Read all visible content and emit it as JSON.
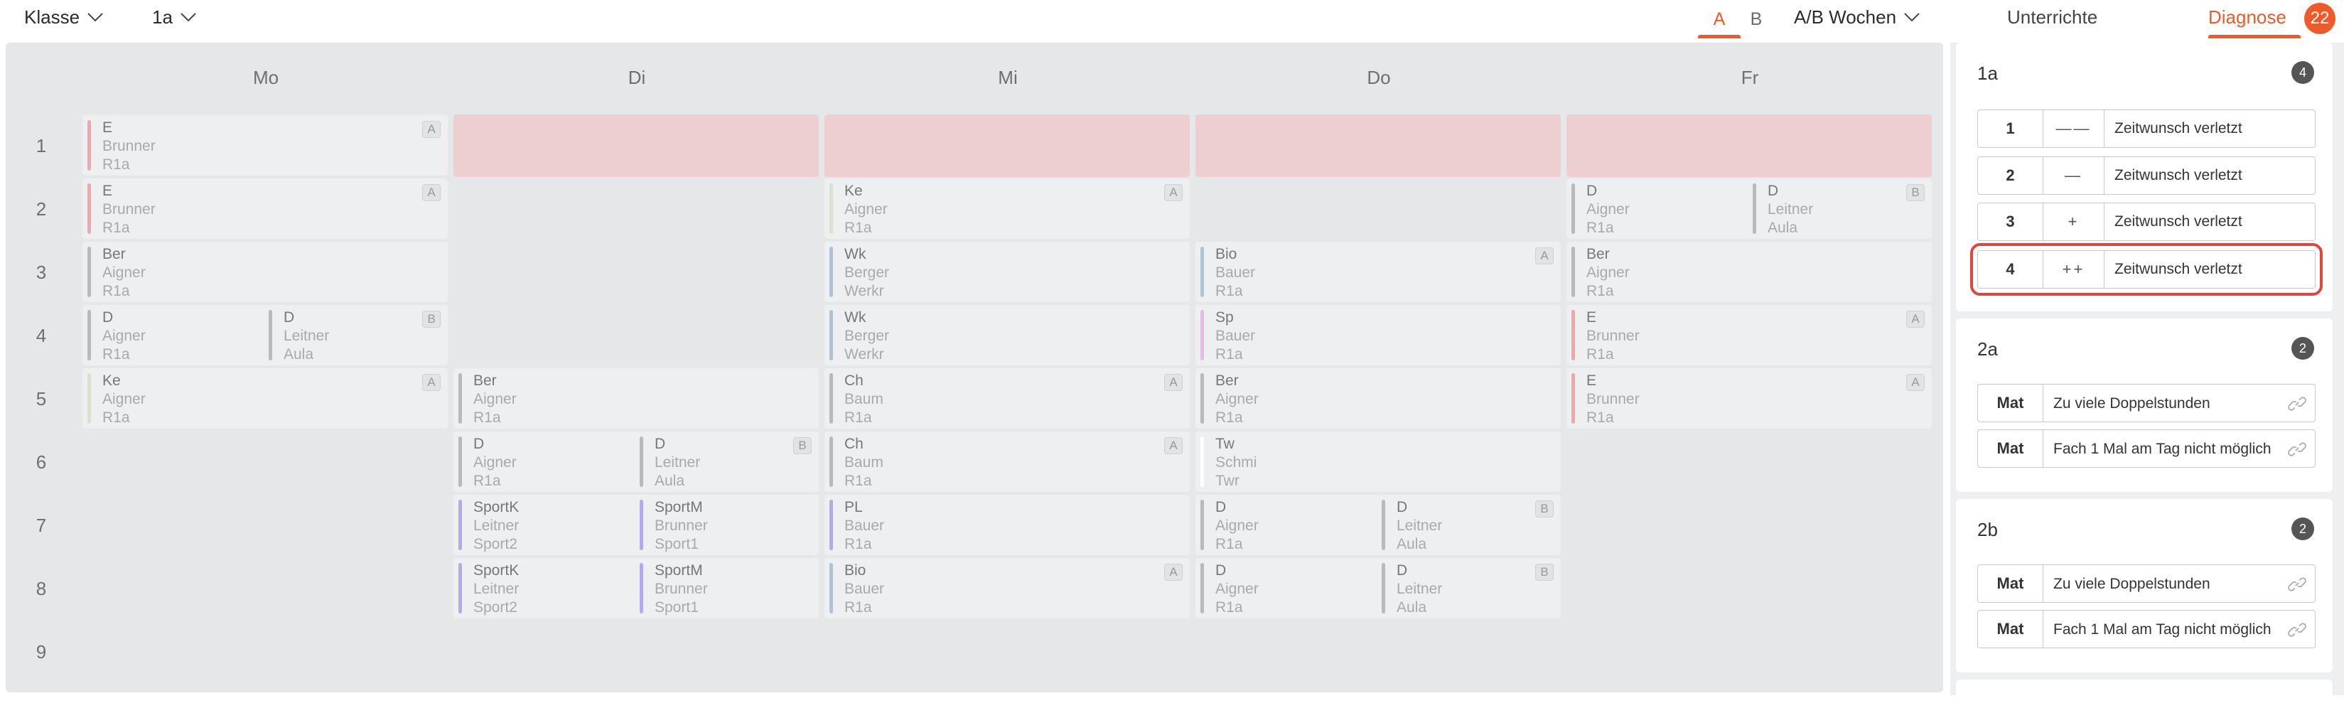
{
  "topbar": {
    "klasse_label": "Klasse",
    "class_value": "1a",
    "ab_tab_a": "A",
    "ab_tab_b": "B",
    "ab_weeks_label": "A/B Wochen",
    "tab_unterrichte": "Unterrichte",
    "tab_diagnose": "Diagnose",
    "diagnose_count": "22",
    "accent_color": "#f05a28"
  },
  "timetable": {
    "days": [
      "Mo",
      "Di",
      "Mi",
      "Do",
      "Fr"
    ],
    "periods": [
      "1",
      "2",
      "3",
      "4",
      "5",
      "6",
      "7",
      "8",
      "9"
    ],
    "lessons": {
      "mo1": {
        "subject": "E",
        "teacher": "Brunner",
        "room": "R1a",
        "tag": "A"
      },
      "mo2": {
        "subject": "E",
        "teacher": "Brunner",
        "room": "R1a",
        "tag": "A"
      },
      "mo3": {
        "subject": "Ber",
        "teacher": "Aigner",
        "room": "R1a"
      },
      "mo4a": {
        "subject": "D",
        "teacher": "Aigner",
        "room": "R1a"
      },
      "mo4b": {
        "subject": "D",
        "teacher": "Leitner",
        "room": "Aula",
        "tag": "B"
      },
      "mo5": {
        "subject": "Ke",
        "teacher": "Aigner",
        "room": "R1a",
        "tag": "A"
      },
      "di5": {
        "subject": "Ber",
        "teacher": "Aigner",
        "room": "R1a"
      },
      "di6a": {
        "subject": "D",
        "teacher": "Aigner",
        "room": "R1a"
      },
      "di6b": {
        "subject": "D",
        "teacher": "Leitner",
        "room": "Aula",
        "tag": "B"
      },
      "di7a": {
        "subject": "SportK",
        "teacher": "Leitner",
        "room": "Sport2"
      },
      "di7b": {
        "subject": "SportM",
        "teacher": "Brunner",
        "room": "Sport1"
      },
      "di8a": {
        "subject": "SportK",
        "teacher": "Leitner",
        "room": "Sport2"
      },
      "di8b": {
        "subject": "SportM",
        "teacher": "Brunner",
        "room": "Sport1"
      },
      "mi2": {
        "subject": "Ke",
        "teacher": "Aigner",
        "room": "R1a",
        "tag": "A"
      },
      "mi3": {
        "subject": "Wk",
        "teacher": "Berger",
        "room": "Werkr"
      },
      "mi4": {
        "subject": "Wk",
        "teacher": "Berger",
        "room": "Werkr"
      },
      "mi5": {
        "subject": "Ch",
        "teacher": "Baum",
        "room": "R1a",
        "tag": "A"
      },
      "mi6": {
        "subject": "Ch",
        "teacher": "Baum",
        "room": "R1a",
        "tag": "A"
      },
      "mi7": {
        "subject": "PL",
        "teacher": "Bauer",
        "room": "R1a"
      },
      "mi8": {
        "subject": "Bio",
        "teacher": "Bauer",
        "room": "R1a",
        "tag": "A"
      },
      "do3": {
        "subject": "Bio",
        "teacher": "Bauer",
        "room": "R1a",
        "tag": "A"
      },
      "do4": {
        "subject": "Sp",
        "teacher": "Bauer",
        "room": "R1a"
      },
      "do5": {
        "subject": "Ber",
        "teacher": "Aigner",
        "room": "R1a"
      },
      "do6": {
        "subject": "Tw",
        "teacher": "Schmi",
        "room": "Twr"
      },
      "do7a": {
        "subject": "D",
        "teacher": "Aigner",
        "room": "R1a"
      },
      "do7b": {
        "subject": "D",
        "teacher": "Leitner",
        "room": "Aula",
        "tag": "B"
      },
      "do8a": {
        "subject": "D",
        "teacher": "Aigner",
        "room": "R1a"
      },
      "do8b": {
        "subject": "D",
        "teacher": "Leitner",
        "room": "Aula",
        "tag": "B"
      },
      "fr2a": {
        "subject": "D",
        "teacher": "Aigner",
        "room": "R1a"
      },
      "fr2b": {
        "subject": "D",
        "teacher": "Leitner",
        "room": "Aula",
        "tag": "B"
      },
      "fr3": {
        "subject": "Ber",
        "teacher": "Aigner",
        "room": "R1a"
      },
      "fr4": {
        "subject": "E",
        "teacher": "Brunner",
        "room": "R1a",
        "tag": "A"
      },
      "fr5": {
        "subject": "E",
        "teacher": "Brunner",
        "room": "R1a",
        "tag": "A"
      }
    },
    "colors": {
      "english": "#f2a6a8",
      "neutral": "#b9b9bb",
      "religion": "#d6e5c8",
      "werken": "#a7c6dc",
      "sport": "#b3a9ef",
      "sp": "#e9b8e4",
      "blocked": "#eecfd1"
    }
  },
  "diagnose": {
    "sections": [
      {
        "title": "1a",
        "count": "4",
        "rows": [
          {
            "period": "1",
            "symbol": "——",
            "text": "Zeitwunsch verletzt"
          },
          {
            "period": "2",
            "symbol": "—",
            "text": "Zeitwunsch verletzt"
          },
          {
            "period": "3",
            "symbol": "+",
            "text": "Zeitwunsch verletzt"
          },
          {
            "period": "4",
            "symbol": "++",
            "text": "Zeitwunsch verletzt"
          }
        ]
      },
      {
        "title": "2a",
        "count": "2",
        "rows": [
          {
            "subject": "Mat",
            "text": "Zu viele Doppelstunden"
          },
          {
            "subject": "Mat",
            "text": "Fach 1 Mal am Tag nicht möglich"
          }
        ]
      },
      {
        "title": "2b",
        "count": "2",
        "rows": [
          {
            "subject": "Mat",
            "text": "Zu viele Doppelstunden"
          },
          {
            "subject": "Mat",
            "text": "Fach 1 Mal am Tag nicht möglich"
          }
        ]
      }
    ],
    "highlight_color": "#e0473c"
  }
}
